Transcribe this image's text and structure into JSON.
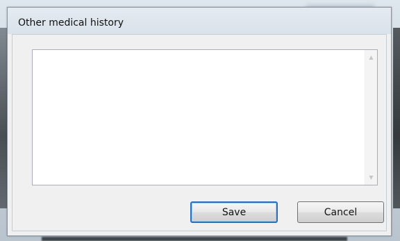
{
  "dialog": {
    "title": "Other medical history",
    "notes_value": "",
    "save_label": "Save",
    "cancel_label": "Cancel"
  },
  "scrollbar": {
    "up_icon": "chevron-up-icon",
    "down_icon": "chevron-down-icon"
  },
  "colors": {
    "default_button_border": "#2f6db5",
    "dialog_background": "#f0f0f0"
  }
}
